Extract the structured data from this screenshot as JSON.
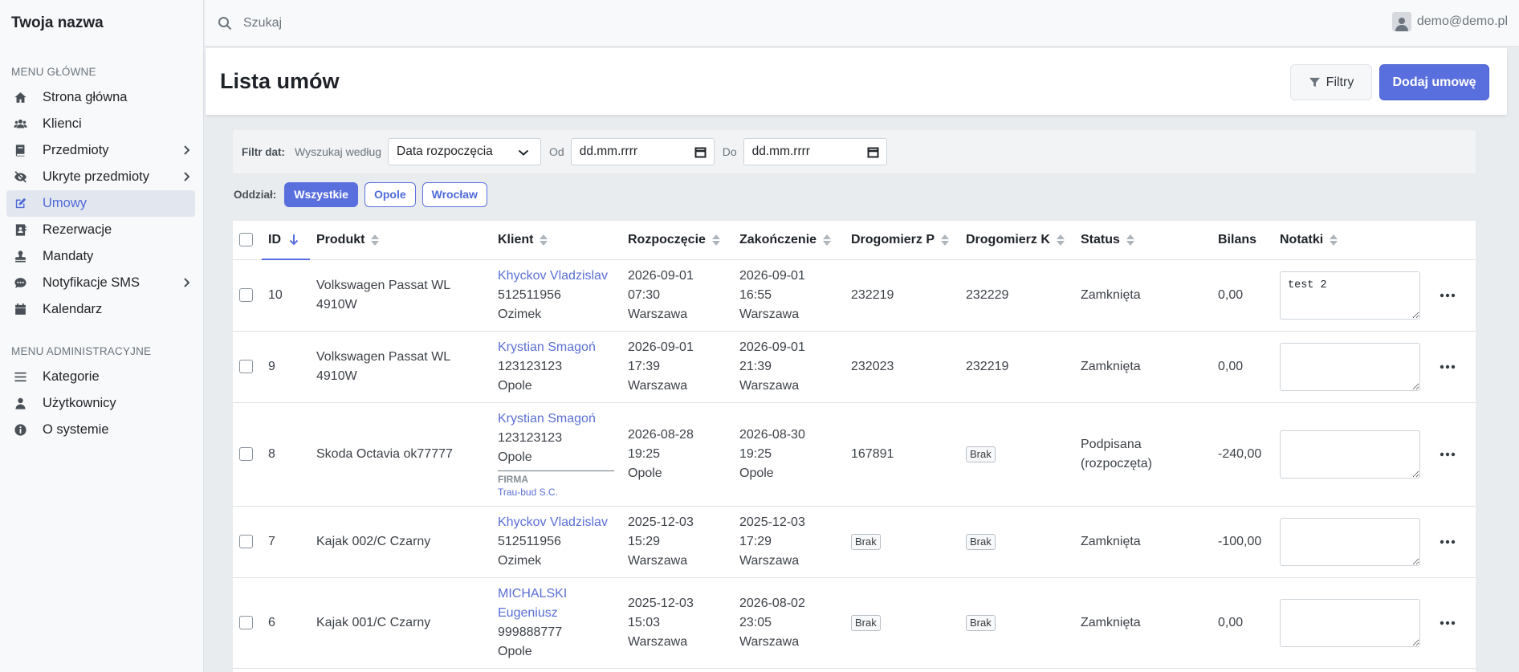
{
  "app": {
    "brand": "Twoja nazwa"
  },
  "search": {
    "placeholder": "Szukaj"
  },
  "user": {
    "email": "demo@demo.pl"
  },
  "sidebar": {
    "main_heading": "MENU GŁÓWNE",
    "main_items": [
      {
        "label": "Strona główna",
        "icon": "home-icon"
      },
      {
        "label": "Klienci",
        "icon": "users-icon"
      },
      {
        "label": "Przedmioty",
        "icon": "book-icon",
        "has_submenu": true
      },
      {
        "label": "Ukryte przedmioty",
        "icon": "eye-slash-icon",
        "has_submenu": true
      },
      {
        "label": "Umowy",
        "icon": "edit-icon",
        "active": true
      },
      {
        "label": "Rezerwacje",
        "icon": "address-book-icon"
      },
      {
        "label": "Mandaty",
        "icon": "stamp-icon"
      },
      {
        "label": "Notyfikacje SMS",
        "icon": "comment-dots-icon",
        "has_submenu": true
      },
      {
        "label": "Kalendarz",
        "icon": "calendar-icon"
      }
    ],
    "admin_heading": "MENU ADMINISTRACYJNE",
    "admin_items": [
      {
        "label": "Kategorie",
        "icon": "list-icon"
      },
      {
        "label": "Użytkownicy",
        "icon": "user-icon"
      },
      {
        "label": "O systemie",
        "icon": "info-icon"
      }
    ]
  },
  "header": {
    "title": "Lista umów",
    "filter_label": "Filtry",
    "add_label": "Dodaj umowę"
  },
  "date_filter": {
    "label": "Filtr dat:",
    "search_by_label": "Wyszukaj według",
    "search_by_value": "Data rozpoczęcia",
    "from_label": "Od",
    "from_value": "dd.mm.rrrr",
    "to_label": "Do",
    "to_value": "dd.mm.rrrr"
  },
  "branch_filter": {
    "label": "Oddział:",
    "options": [
      "Wszystkie",
      "Opole",
      "Wrocław"
    ],
    "active": "Wszystkie"
  },
  "table": {
    "columns": [
      "ID",
      "Produkt",
      "Klient",
      "Rozpoczęcie",
      "Zakończenie",
      "Drogomierz P",
      "Drogomierz K",
      "Status",
      "Bilans",
      "Notatki"
    ],
    "rows": [
      {
        "id": "10",
        "product": "Volkswagen Passat WL 4910W",
        "client_name": "Khyckov Vladzislav",
        "client_phone": "512511956",
        "client_city": "Ozimek",
        "start_date": "2026-09-01",
        "start_time": "07:30",
        "start_place": "Warszawa",
        "end_date": "2026-09-01",
        "end_time": "16:55",
        "end_place": "Warszawa",
        "odo_start": "232219",
        "odo_end": "232229",
        "status": "Zamknięta",
        "balance": "0,00",
        "note": "test 2"
      },
      {
        "id": "9",
        "product": "Volkswagen Passat WL 4910W",
        "client_name": "Krystian Smagoń",
        "client_phone": "123123123",
        "client_city": "Opole",
        "start_date": "2026-09-01",
        "start_time": "17:39",
        "start_place": "Warszawa",
        "end_date": "2026-09-01",
        "end_time": "21:39",
        "end_place": "Warszawa",
        "odo_start": "232023",
        "odo_end": "232219",
        "status": "Zamknięta",
        "balance": "0,00",
        "note": ""
      },
      {
        "id": "8",
        "product": "Skoda Octavia ok77777",
        "client_name": "Krystian Smagoń",
        "client_phone": "123123123",
        "client_city": "Opole",
        "company_label": "FIRMA",
        "company_name": "Trau-bud S.C.",
        "start_date": "2026-08-28",
        "start_time": "19:25",
        "start_place": "Opole",
        "end_date": "2026-08-30",
        "end_time": "19:25",
        "end_place": "Opole",
        "odo_start": "167891",
        "odo_end": "Brak",
        "status": "Podpisana (rozpoczęta)",
        "balance": "-240,00",
        "note": ""
      },
      {
        "id": "7",
        "product": "Kajak 002/C Czarny",
        "client_name": "Khyckov Vladzislav",
        "client_phone": "512511956",
        "client_city": "Ozimek",
        "start_date": "2025-12-03",
        "start_time": "15:29",
        "start_place": "Warszawa",
        "end_date": "2025-12-03",
        "end_time": "17:29",
        "end_place": "Warszawa",
        "odo_start": "Brak",
        "odo_end": "Brak",
        "status": "Zamknięta",
        "balance": "-100,00",
        "note": ""
      },
      {
        "id": "6",
        "product": "Kajak 001/C Czarny",
        "client_name": "MICHALSKI Eugeniusz",
        "client_phone": "999888777",
        "client_city": "Opole",
        "start_date": "2025-12-03",
        "start_time": "15:03",
        "start_place": "Warszawa",
        "end_date": "2026-08-02",
        "end_time": "23:05",
        "end_place": "Warszawa",
        "odo_start": "Brak",
        "odo_end": "Brak",
        "status": "Zamknięta",
        "balance": "0,00",
        "note": ""
      }
    ]
  },
  "colors": {
    "accent": "#5a6fde",
    "link": "#5a6fd6",
    "sidebar_bg": "#f8f9fa",
    "page_bg": "#e9ecef"
  }
}
